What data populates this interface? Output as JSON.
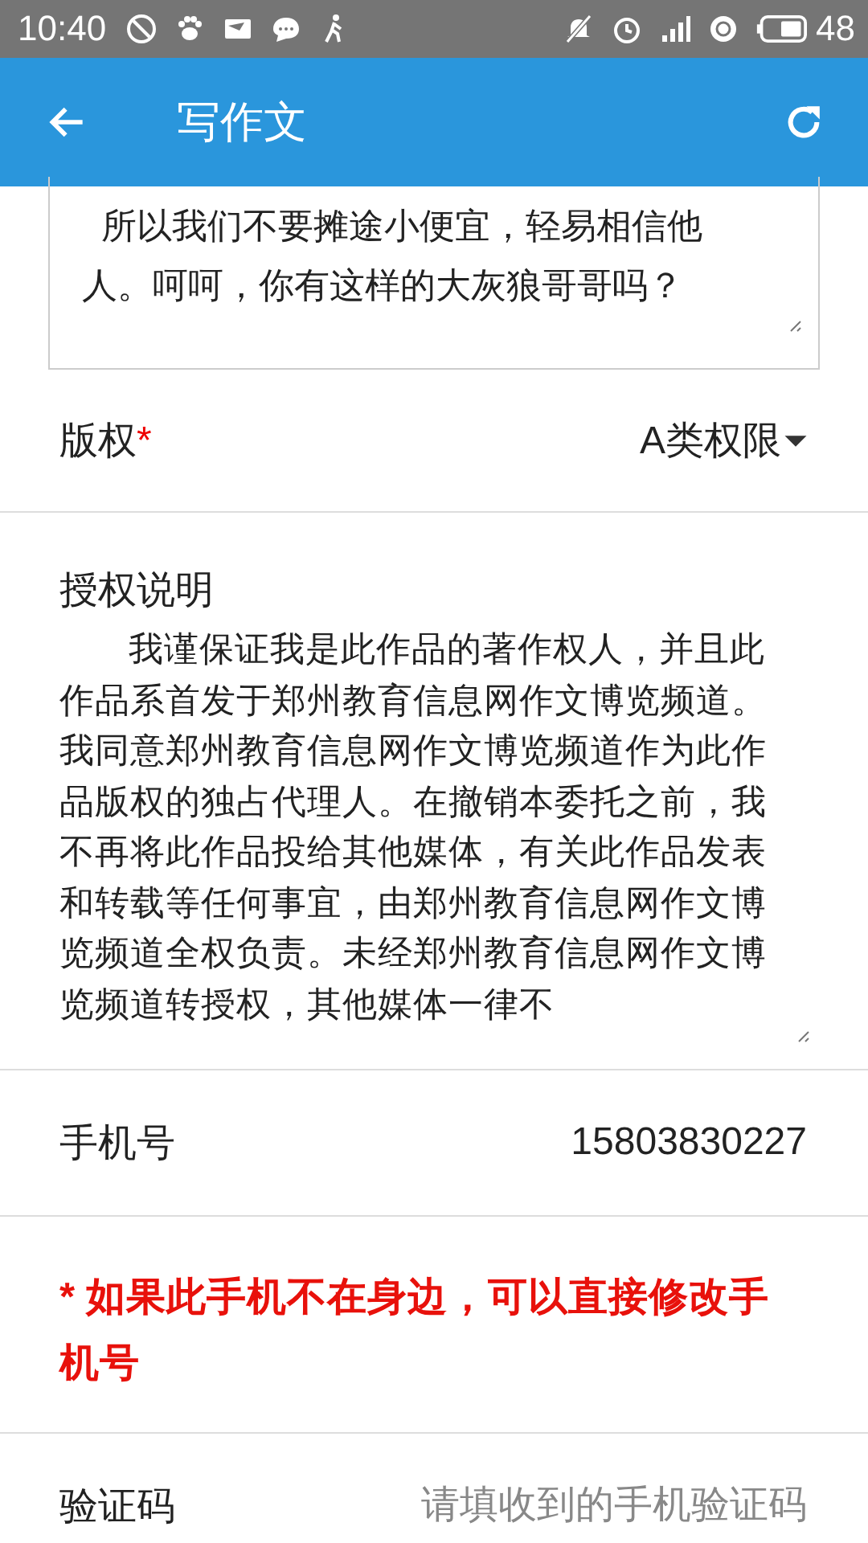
{
  "status_bar": {
    "time": "10:40",
    "battery_text": "48"
  },
  "app_bar": {
    "title": "写作文"
  },
  "essay": {
    "lines": [
      "所以我们不要摊途小便宜，轻易相信他",
      "人。呵呵，你有这样的大灰狼哥哥吗？"
    ]
  },
  "copyright": {
    "label": "版权",
    "required_mark": "*",
    "value": "A类权限"
  },
  "authorization": {
    "label": "授权说明",
    "text": "我谨保证我是此作品的著作权人，并且此作品系首发于郑州教育信息网作文博览频道。我同意郑州教育信息网作文博览频道作为此作品版权的独占代理人。在撤销本委托之前，我不再将此作品投给其他媒体，有关此作品发表和转载等任何事宜，由郑州教育信息网作文博览频道全权负责。未经郑州教育信息网作文博览频道转授权，其他媒体一律不"
  },
  "phone": {
    "label": "手机号",
    "value": "15803830227"
  },
  "notice": "* 如果此手机不在身边，可以直接修改手机号",
  "code": {
    "label": "验证码",
    "placeholder": "请填收到的手机验证码"
  }
}
